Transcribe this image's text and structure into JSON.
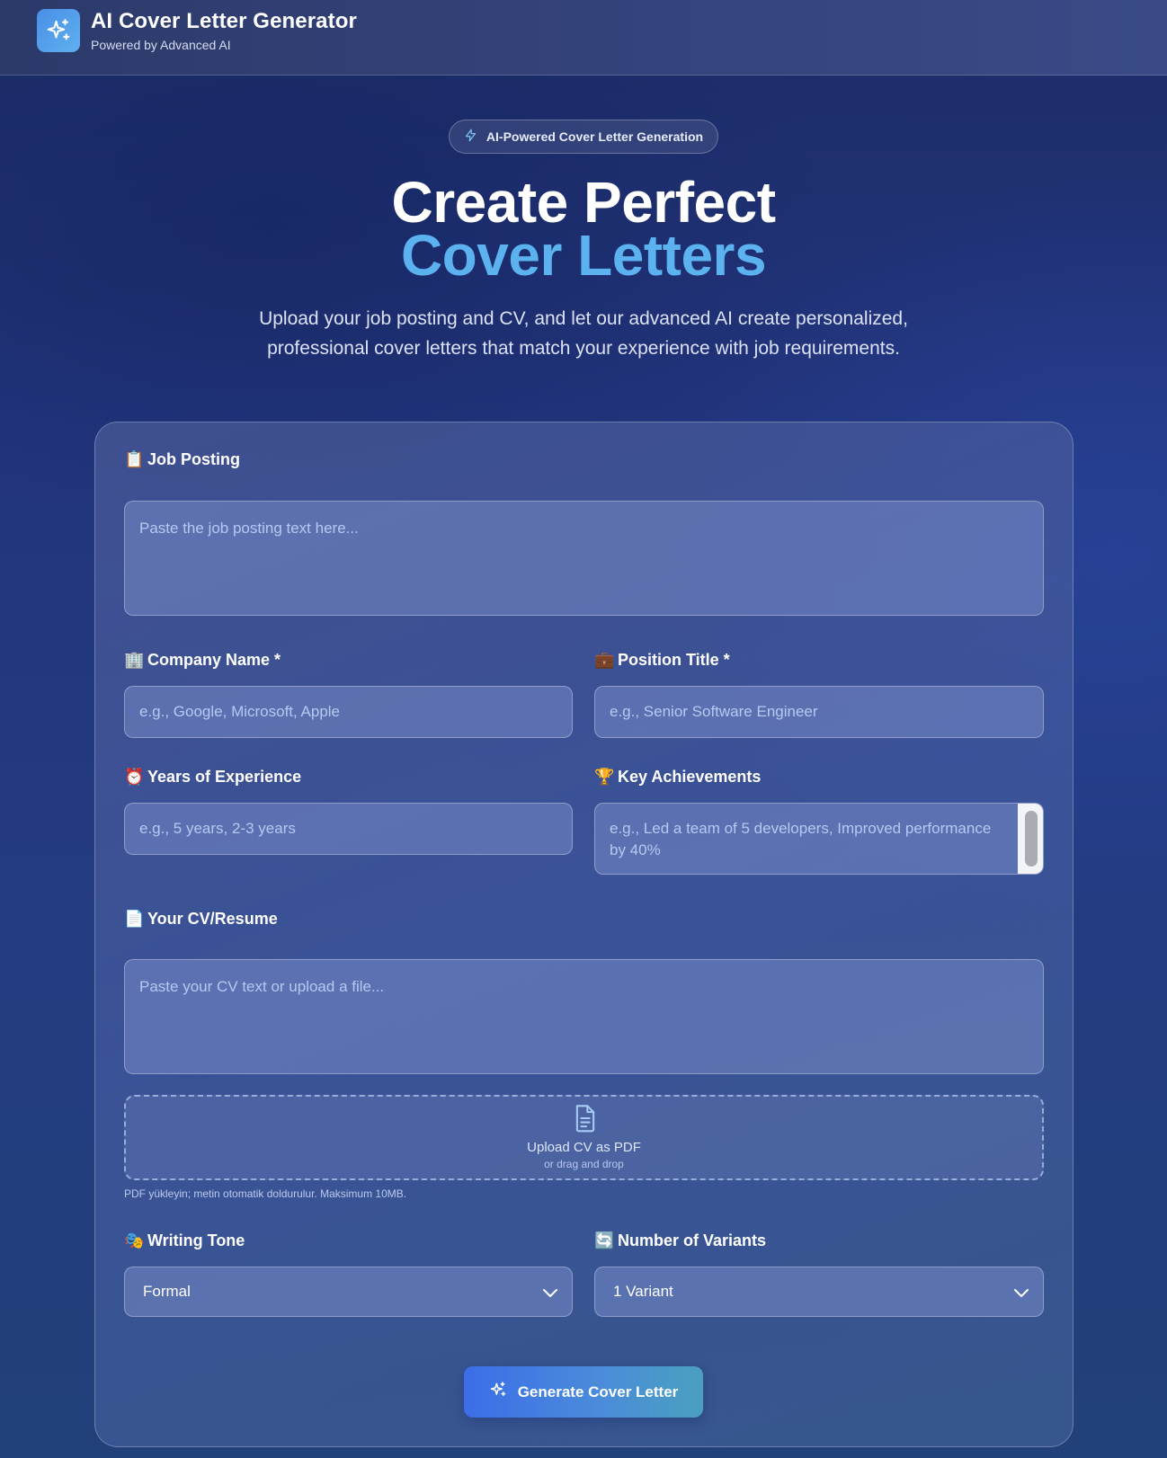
{
  "header": {
    "title": "AI Cover Letter Generator",
    "subtitle": "Powered by Advanced AI"
  },
  "hero": {
    "badge": "AI-Powered Cover Letter Generation",
    "title_line1": "Create Perfect",
    "title_line2": "Cover Letters",
    "description": "Upload your job posting and CV, and let our advanced AI create personalized, professional cover letters that match your experience with job requirements."
  },
  "form": {
    "job_posting": {
      "emoji": "📋",
      "label": "Job Posting",
      "placeholder": "Paste the job posting text here...",
      "value": ""
    },
    "company_name": {
      "emoji": "🏢",
      "label": "Company Name *",
      "placeholder": "e.g., Google, Microsoft, Apple",
      "value": ""
    },
    "position_title": {
      "emoji": "💼",
      "label": "Position Title *",
      "placeholder": "e.g., Senior Software Engineer",
      "value": ""
    },
    "years_experience": {
      "emoji": "⏰",
      "label": "Years of Experience",
      "placeholder": "e.g., 5 years, 2-3 years",
      "value": ""
    },
    "key_achievements": {
      "emoji": "🏆",
      "label": "Key Achievements",
      "placeholder": "e.g., Led a team of 5 developers, Improved performance by 40%",
      "value": ""
    },
    "cv": {
      "emoji": "📄",
      "label": "Your CV/Resume",
      "placeholder": "Paste your CV text or upload a file...",
      "value": ""
    },
    "upload": {
      "title": "Upload CV as PDF",
      "subtitle": "or drag and drop",
      "hint": "PDF yükleyin; metin otomatik doldurulur. Maksimum 10MB."
    },
    "writing_tone": {
      "emoji": "🎭",
      "label": "Writing Tone",
      "selected": "Formal"
    },
    "variants": {
      "emoji": "🔄",
      "label": "Number of Variants",
      "selected": "1 Variant"
    },
    "generate_label": "Generate Cover Letter"
  },
  "colors": {
    "accent_blue": "#5cb2ef",
    "button_start": "#3b6de8",
    "button_end": "#4aa0c0"
  },
  "icons": [
    "sparkles-icon",
    "lightning-icon",
    "file-icon",
    "chevron-down-icon"
  ]
}
